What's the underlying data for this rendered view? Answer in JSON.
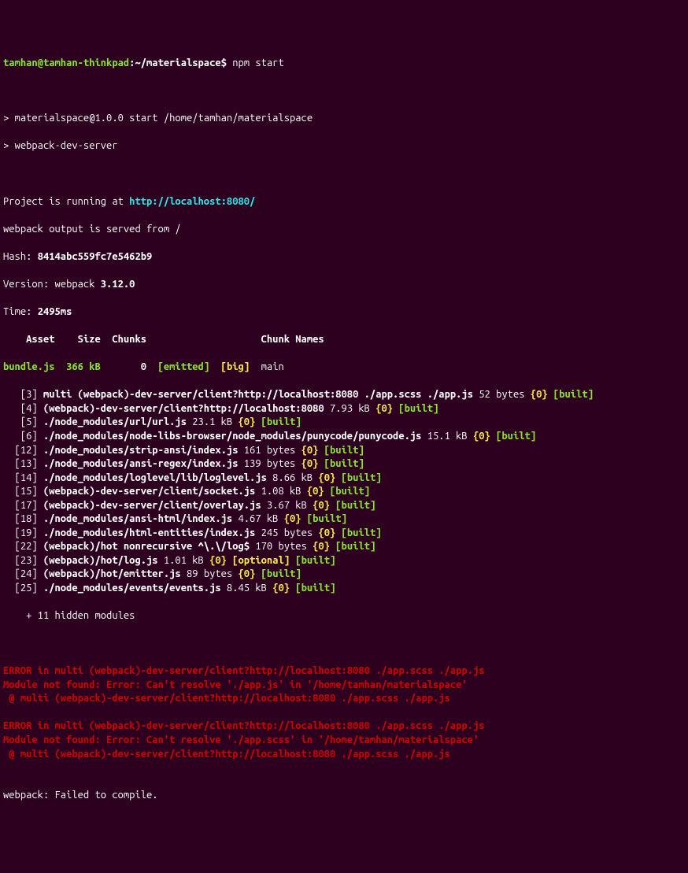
{
  "prompt": {
    "user_host": "tamhan@tamhan-thinkpad",
    "path": ":~/materialspace$ ",
    "cmd": "npm start"
  },
  "npm": {
    "l1": "> materialspace@1.0.0 start /home/tamhan/materialspace",
    "l2": "> webpack-dev-server"
  },
  "info": {
    "running_prefix": "Project is running at ",
    "running_url": "http://localhost:8080/",
    "served": "webpack output is served from /",
    "hash_label": "Hash: ",
    "hash": "8414abc559fc7e5462b9",
    "version_label": "Version: webpack ",
    "version": "3.12.0",
    "time_label": "Time: ",
    "time": "2495ms"
  },
  "header": "    Asset    Size  Chunks                    Chunk Names",
  "bundle": {
    "asset": "bundle.js",
    "size": "  366 kB",
    "chunks": "       0  ",
    "emitted": "[emitted]",
    "big": "  [big]  ",
    "name": "main"
  },
  "modules": [
    {
      "id": "   [3] ",
      "path": "multi (webpack)-dev-server/client?http://localhost:8080 ./app.scss ./app.js",
      "size": " 52 bytes ",
      "chunk": "{0}",
      "sep": " ",
      "flag": "[built]"
    },
    {
      "id": "   [4] ",
      "path": "(webpack)-dev-server/client?http://localhost:8080",
      "size": " 7.93 kB ",
      "chunk": "{0}",
      "sep": " ",
      "flag": "[built]"
    },
    {
      "id": "   [5] ",
      "path": "./node_modules/url/url.js",
      "size": " 23.1 kB ",
      "chunk": "{0}",
      "sep": " ",
      "flag": "[built]"
    },
    {
      "id": "   [6] ",
      "path": "./node_modules/node-libs-browser/node_modules/punycode/punycode.js",
      "size": " 15.1 kB ",
      "chunk": "{0}",
      "sep": " ",
      "flag": "[built]"
    },
    {
      "id": "  [12] ",
      "path": "./node_modules/strip-ansi/index.js",
      "size": " 161 bytes ",
      "chunk": "{0}",
      "sep": " ",
      "flag": "[built]"
    },
    {
      "id": "  [13] ",
      "path": "./node_modules/ansi-regex/index.js",
      "size": " 139 bytes ",
      "chunk": "{0}",
      "sep": " ",
      "flag": "[built]"
    },
    {
      "id": "  [14] ",
      "path": "./node_modules/loglevel/lib/loglevel.js",
      "size": " 8.66 kB ",
      "chunk": "{0}",
      "sep": " ",
      "flag": "[built]"
    },
    {
      "id": "  [15] ",
      "path": "(webpack)-dev-server/client/socket.js",
      "size": " 1.08 kB ",
      "chunk": "{0}",
      "sep": " ",
      "flag": "[built]"
    },
    {
      "id": "  [17] ",
      "path": "(webpack)-dev-server/client/overlay.js",
      "size": " 3.67 kB ",
      "chunk": "{0}",
      "sep": " ",
      "flag": "[built]"
    },
    {
      "id": "  [18] ",
      "path": "./node_modules/ansi-html/index.js",
      "size": " 4.67 kB ",
      "chunk": "{0}",
      "sep": " ",
      "flag": "[built]"
    },
    {
      "id": "  [19] ",
      "path": "./node_modules/html-entities/index.js",
      "size": " 245 bytes ",
      "chunk": "{0}",
      "sep": " ",
      "flag": "[built]"
    },
    {
      "id": "  [22] ",
      "path": "(webpack)/hot nonrecursive ^\\.\\/log$",
      "size": " 170 bytes ",
      "chunk": "{0}",
      "sep": " ",
      "flag": "[built]"
    },
    {
      "id": "  [23] ",
      "path": "(webpack)/hot/log.js",
      "size": " 1.01 kB ",
      "chunk": "{0}",
      "sep": " ",
      "opt": "[optional]",
      "flag": "[built]"
    },
    {
      "id": "  [24] ",
      "path": "(webpack)/hot/emitter.js",
      "size": " 89 bytes ",
      "chunk": "{0}",
      "sep": " ",
      "flag": "[built]"
    },
    {
      "id": "  [25] ",
      "path": "./node_modules/events/events.js",
      "size": " 8.45 kB ",
      "chunk": "{0}",
      "sep": " ",
      "flag": "[built]"
    }
  ],
  "hidden": "    + 11 hidden modules",
  "errors": [
    {
      "l1": "ERROR in multi (webpack)-dev-server/client?http://localhost:8080 ./app.scss ./app.js",
      "l2": "Module not found: Error: Can't resolve './app.js' in '/home/tamhan/materialspace'",
      "l3": " @ multi (webpack)-dev-server/client?http://localhost:8080 ./app.scss ./app.js"
    },
    {
      "l1": "ERROR in multi (webpack)-dev-server/client?http://localhost:8080 ./app.scss ./app.js",
      "l2": "Module not found: Error: Can't resolve './app.scss' in '/home/tamhan/materialspace'",
      "l3": " @ multi (webpack)-dev-server/client?http://localhost:8080 ./app.scss ./app.js"
    }
  ],
  "final": "webpack: Failed to compile."
}
